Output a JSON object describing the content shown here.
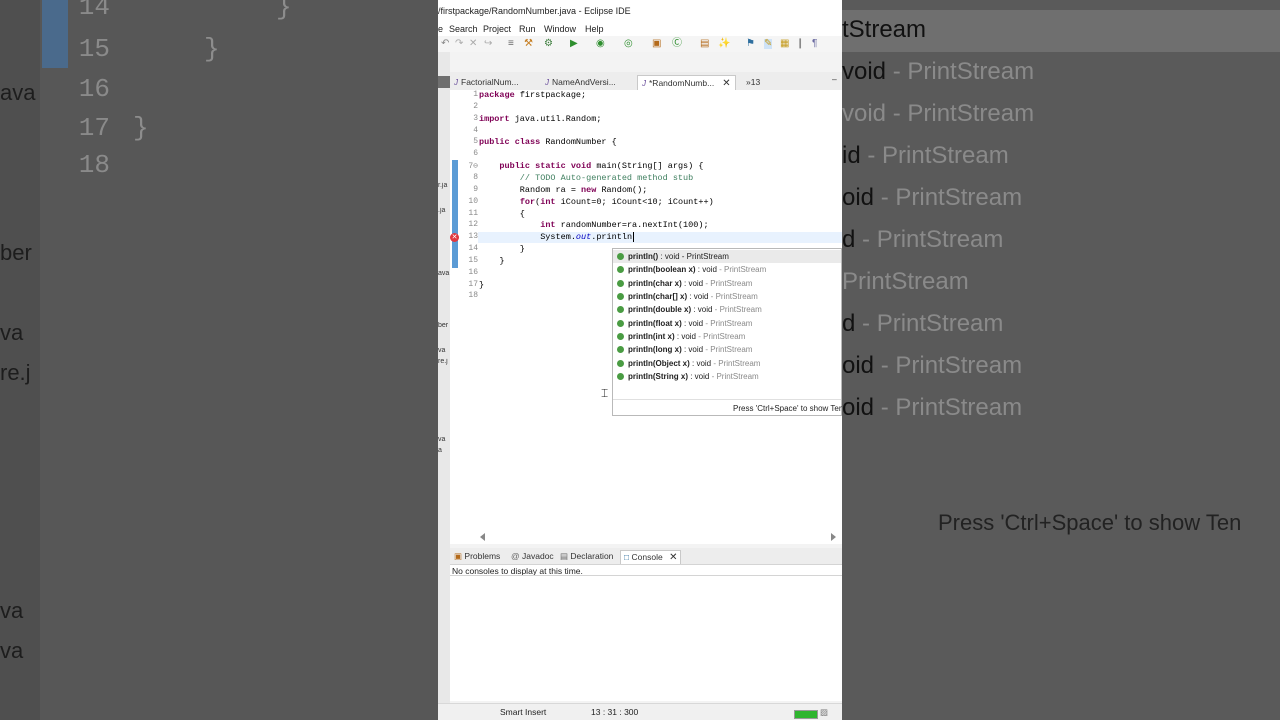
{
  "colors": {
    "keyword": "#7f0055",
    "comment": "#3f7f5f",
    "field": "#0000c0",
    "method_dot": "#4a9c43",
    "error": "#e0383f",
    "heap": "#2fb52f"
  },
  "bg_left": {
    "lines": [
      {
        "num": "14",
        "code": "}"
      },
      {
        "num": "15",
        "code": "}"
      },
      {
        "num": "16",
        "code": ""
      },
      {
        "num": "17",
        "code": "}"
      },
      {
        "num": "18",
        "code": ""
      }
    ],
    "fragments": [
      "ava",
      "ber",
      "va",
      "re.j",
      "va",
      "va"
    ]
  },
  "bg_right": {
    "rows": [
      {
        "strong": "tStream",
        "muted": ""
      },
      {
        "strong": "void",
        "muted": " - PrintStream"
      },
      {
        "strong": "",
        "muted": "void - PrintStream"
      },
      {
        "strong": "id",
        "muted": " - PrintStream"
      },
      {
        "strong": "oid",
        "muted": " - PrintStream"
      },
      {
        "strong": "d",
        "muted": " - PrintStream"
      },
      {
        "strong": "",
        "muted": "PrintStream"
      },
      {
        "strong": "d",
        "muted": " - PrintStream"
      },
      {
        "strong": "oid",
        "muted": " - PrintStream"
      },
      {
        "strong": "oid",
        "muted": " - PrintStream"
      }
    ],
    "hint": "Press 'Ctrl+Space' to show Ten"
  },
  "window": {
    "title": "/firstpackage/RandomNumber.java - Eclipse IDE"
  },
  "menu": [
    "e",
    "Search",
    "Project",
    "Run",
    "Window",
    "Help"
  ],
  "toolbar_icons": [
    "undo-icon",
    "redo-icon",
    "debug-icon",
    "run-icon",
    "coverage-icon",
    "external-tools-icon",
    "new-package-icon",
    "new-class-icon",
    "open-type-icon",
    "search-icon",
    "annotation-icon",
    "mark-occurrences-icon",
    "block-selection-icon",
    "show-whitespace-icon"
  ],
  "tabs": [
    {
      "label": "FactorialNum...",
      "active": false
    },
    {
      "label": "NameAndVersi...",
      "active": false
    },
    {
      "label": "*RandomNumb...",
      "active": true
    }
  ],
  "tabs_overflow": "»13",
  "left_strip_marks": [
    "r.ja",
    ".ja",
    "ava",
    "ber",
    "va",
    "re.j",
    "va",
    "a"
  ],
  "editor": {
    "lines": [
      {
        "num": "1",
        "tokens": [
          {
            "t": "package",
            "c": "kw"
          },
          {
            "t": " firstpackage;",
            "c": ""
          }
        ]
      },
      {
        "num": "2",
        "tokens": []
      },
      {
        "num": "3",
        "tokens": [
          {
            "t": "import",
            "c": "kw"
          },
          {
            "t": " java.util.Random;",
            "c": ""
          }
        ]
      },
      {
        "num": "4",
        "tokens": []
      },
      {
        "num": "5",
        "tokens": [
          {
            "t": "public class",
            "c": "kw"
          },
          {
            "t": " RandomNumber {",
            "c": ""
          }
        ]
      },
      {
        "num": "6",
        "tokens": []
      },
      {
        "num": "7⊖",
        "tokens": [
          {
            "t": "    ",
            "c": ""
          },
          {
            "t": "public static void",
            "c": "kw"
          },
          {
            "t": " main(String[] args) {",
            "c": ""
          }
        ]
      },
      {
        "num": "8",
        "tokens": [
          {
            "t": "        // TODO Auto-generated method stub",
            "c": "cm"
          }
        ]
      },
      {
        "num": "9",
        "tokens": [
          {
            "t": "        Random ra = ",
            "c": ""
          },
          {
            "t": "new",
            "c": "kw"
          },
          {
            "t": " Random();",
            "c": ""
          }
        ]
      },
      {
        "num": "10",
        "tokens": [
          {
            "t": "        ",
            "c": ""
          },
          {
            "t": "for",
            "c": "kw"
          },
          {
            "t": "(",
            "c": ""
          },
          {
            "t": "int",
            "c": "kw"
          },
          {
            "t": " iCount=0; iCount<10; iCount++)",
            "c": ""
          }
        ]
      },
      {
        "num": "11",
        "tokens": [
          {
            "t": "        {",
            "c": ""
          }
        ]
      },
      {
        "num": "12",
        "tokens": [
          {
            "t": "            ",
            "c": ""
          },
          {
            "t": "int",
            "c": "kw"
          },
          {
            "t": " randomNumber=ra.nextInt(100);",
            "c": ""
          }
        ]
      },
      {
        "num": "13",
        "tokens": [
          {
            "t": "            System.",
            "c": ""
          },
          {
            "t": "out",
            "c": "fld"
          },
          {
            "t": ".println",
            "c": ""
          }
        ]
      },
      {
        "num": "14",
        "tokens": [
          {
            "t": "        }",
            "c": ""
          }
        ]
      },
      {
        "num": "15",
        "tokens": [
          {
            "t": "    }",
            "c": ""
          }
        ]
      },
      {
        "num": "16",
        "tokens": []
      },
      {
        "num": "17",
        "tokens": [
          {
            "t": "}",
            "c": ""
          }
        ]
      },
      {
        "num": "18",
        "tokens": []
      }
    ]
  },
  "autocomplete": {
    "items": [
      {
        "sig": "println()",
        "ret": " : void",
        "owner": " - PrintStream"
      },
      {
        "sig": "println(boolean x)",
        "ret": " : void",
        "owner": " - PrintStream"
      },
      {
        "sig": "println(char x)",
        "ret": " : void",
        "owner": " - PrintStream"
      },
      {
        "sig": "println(char[] x)",
        "ret": " : void",
        "owner": " - PrintStream"
      },
      {
        "sig": "println(double x)",
        "ret": " : void",
        "owner": " - PrintStream"
      },
      {
        "sig": "println(float x)",
        "ret": " : void",
        "owner": " - PrintStream"
      },
      {
        "sig": "println(int x)",
        "ret": " : void",
        "owner": " - PrintStream"
      },
      {
        "sig": "println(long x)",
        "ret": " : void",
        "owner": " - PrintStream"
      },
      {
        "sig": "println(Object x)",
        "ret": " : void",
        "owner": " - PrintStream"
      },
      {
        "sig": "println(String x)",
        "ret": " : void",
        "owner": " - PrintStream"
      }
    ],
    "hint": "Press 'Ctrl+Space' to show Ten"
  },
  "bottom_tabs": [
    {
      "label": "Problems",
      "active": false
    },
    {
      "label": "Javadoc",
      "active": false
    },
    {
      "label": "Declaration",
      "active": false
    },
    {
      "label": "Console",
      "active": true
    }
  ],
  "console": {
    "message": "No consoles to display at this time."
  },
  "status": {
    "insert_mode": "Smart Insert",
    "position": "13 : 31 : 300"
  }
}
